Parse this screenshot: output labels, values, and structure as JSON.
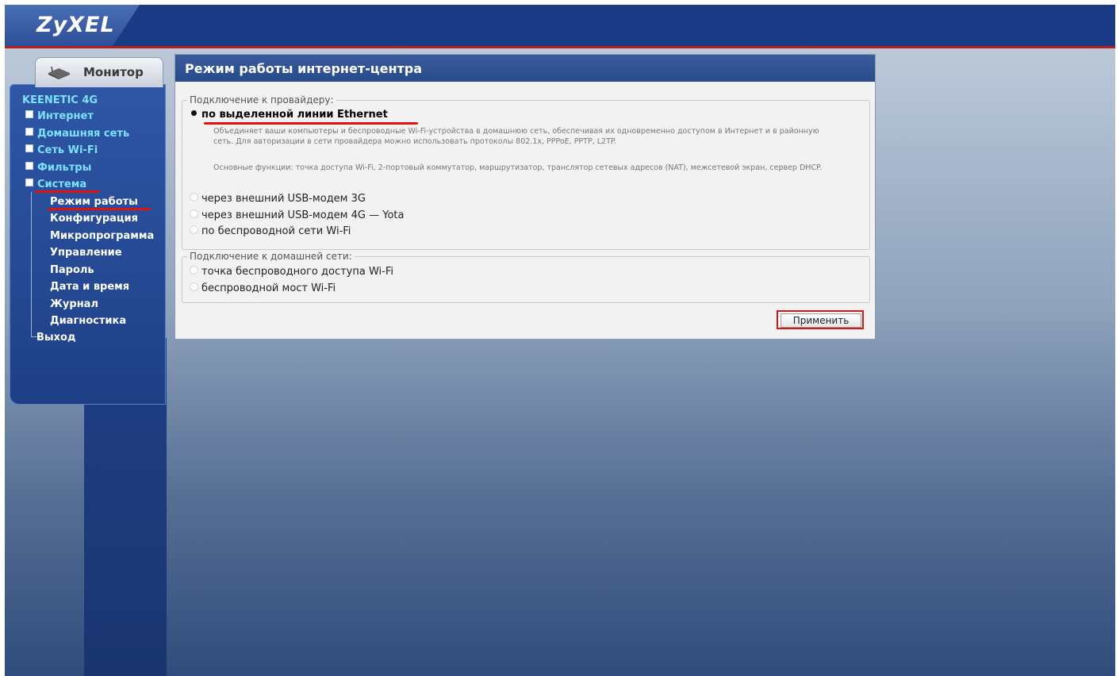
{
  "header": {
    "logo": "ZyXEL",
    "brand_color": "#1a3a85",
    "accent_color": "#b41e1e"
  },
  "sidebar": {
    "monitor_tab": {
      "label": "Монитор",
      "icon": "router-icon"
    },
    "device_title": "KEENETIC 4G",
    "items": [
      {
        "label": "Интернет"
      },
      {
        "label": "Домашняя сеть"
      },
      {
        "label": "Сеть Wi-Fi"
      },
      {
        "label": "Фильтры"
      },
      {
        "label": "Система"
      }
    ],
    "system_subitems": [
      {
        "label": "Режим работы",
        "selected": true
      },
      {
        "label": "Конфигурация"
      },
      {
        "label": "Микропрограмма"
      },
      {
        "label": "Управление"
      },
      {
        "label": "Пароль"
      },
      {
        "label": "Дата и время"
      },
      {
        "label": "Журнал"
      },
      {
        "label": "Диагностика"
      }
    ],
    "exit": "Выход"
  },
  "panel": {
    "title": "Режим работы интернет-центра",
    "provider_group": {
      "legend": "Подключение к провайдеру:",
      "options": [
        {
          "label": "по выделенной линии Ethernet",
          "checked": true
        },
        {
          "label": "через внешний USB-модем 3G",
          "checked": false
        },
        {
          "label": "через внешний USB-модем 4G — Yota",
          "checked": false
        },
        {
          "label": "по беспроводной сети Wi-Fi",
          "checked": false
        }
      ],
      "description_1": "Объединяет ваши компьютеры и беспроводные Wi-Fi-устройства в домашнюю сеть, обеспечивая их одновременно доступом в Интернет и в районную сеть. Для авторизации в сети провайдера можно использовать протоколы 802.1x, PPPoE, PPTP, L2TP.",
      "description_2": "Основные функции: точка доступа Wi-Fi, 2-портовый коммутатор, маршрутизатор, транслятор сетевых адресов (NAT), межсетевой экран, сервер DHCP."
    },
    "home_group": {
      "legend": "Подключение к домашней сети:",
      "options": [
        {
          "label": "точка беспроводного доступа Wi-Fi",
          "checked": false
        },
        {
          "label": "беспроводной мост Wi-Fi",
          "checked": false
        }
      ]
    },
    "apply_label": "Применить"
  }
}
